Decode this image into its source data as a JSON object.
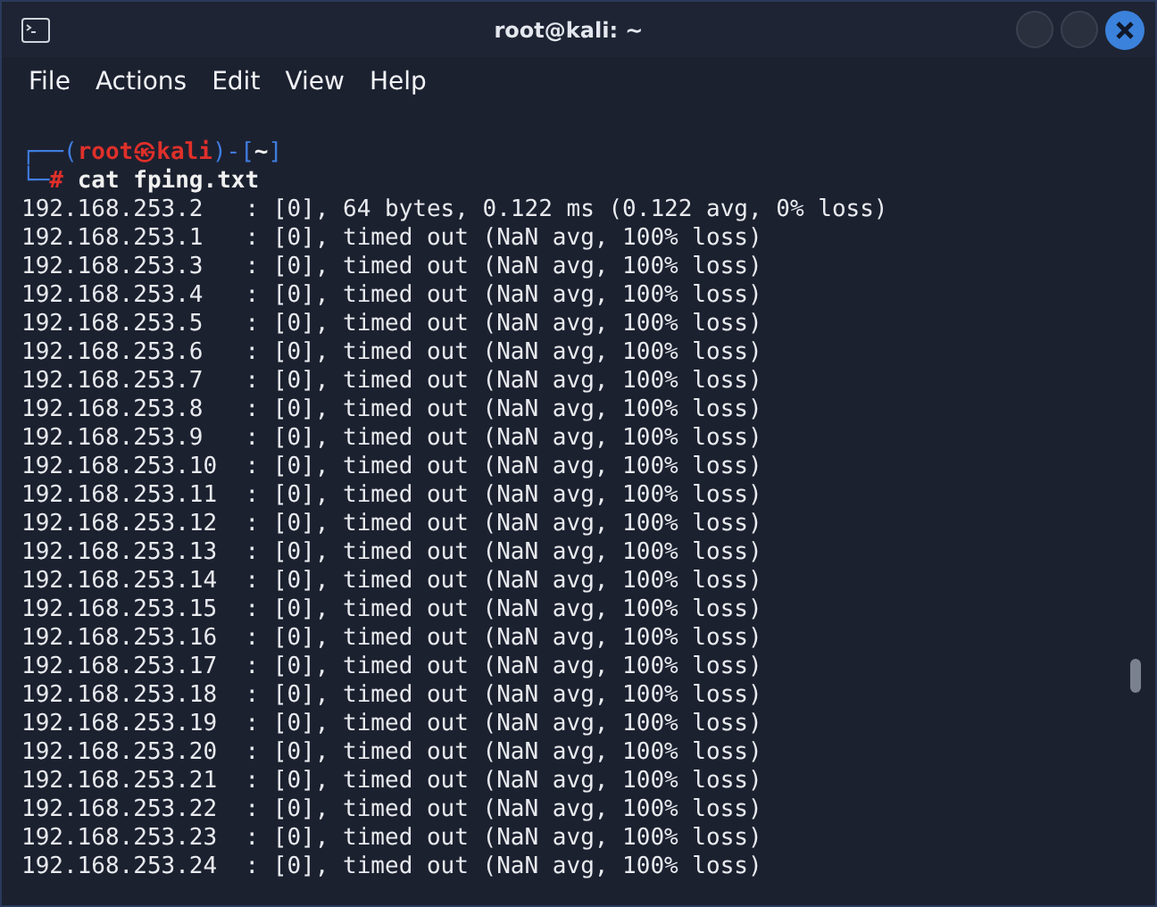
{
  "window": {
    "title": "root@kali: ~"
  },
  "menu": [
    "File",
    "Actions",
    "Edit",
    "View",
    "Help"
  ],
  "prompt": {
    "frame_top": "┌──(",
    "user": "root㉿kali",
    "mid": ")-[",
    "dir": "~",
    "end": "]",
    "frame_bottom": "└─",
    "symbol": "#",
    "command": "cat fping.txt"
  },
  "output": [
    "192.168.253.2   : [0], 64 bytes, 0.122 ms (0.122 avg, 0% loss)",
    "192.168.253.1   : [0], timed out (NaN avg, 100% loss)",
    "192.168.253.3   : [0], timed out (NaN avg, 100% loss)",
    "192.168.253.4   : [0], timed out (NaN avg, 100% loss)",
    "192.168.253.5   : [0], timed out (NaN avg, 100% loss)",
    "192.168.253.6   : [0], timed out (NaN avg, 100% loss)",
    "192.168.253.7   : [0], timed out (NaN avg, 100% loss)",
    "192.168.253.8   : [0], timed out (NaN avg, 100% loss)",
    "192.168.253.9   : [0], timed out (NaN avg, 100% loss)",
    "192.168.253.10  : [0], timed out (NaN avg, 100% loss)",
    "192.168.253.11  : [0], timed out (NaN avg, 100% loss)",
    "192.168.253.12  : [0], timed out (NaN avg, 100% loss)",
    "192.168.253.13  : [0], timed out (NaN avg, 100% loss)",
    "192.168.253.14  : [0], timed out (NaN avg, 100% loss)",
    "192.168.253.15  : [0], timed out (NaN avg, 100% loss)",
    "192.168.253.16  : [0], timed out (NaN avg, 100% loss)",
    "192.168.253.17  : [0], timed out (NaN avg, 100% loss)",
    "192.168.253.18  : [0], timed out (NaN avg, 100% loss)",
    "192.168.253.19  : [0], timed out (NaN avg, 100% loss)",
    "192.168.253.20  : [0], timed out (NaN avg, 100% loss)",
    "192.168.253.21  : [0], timed out (NaN avg, 100% loss)",
    "192.168.253.22  : [0], timed out (NaN avg, 100% loss)",
    "192.168.253.23  : [0], timed out (NaN avg, 100% loss)",
    "192.168.253.24  : [0], timed out (NaN avg, 100% loss)"
  ]
}
